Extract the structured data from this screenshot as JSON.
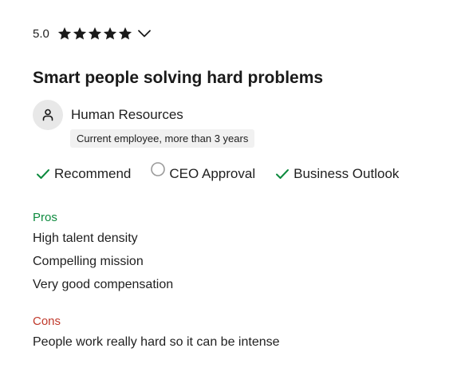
{
  "review": {
    "rating": "5.0",
    "stars": 5,
    "max_stars": 5,
    "title": "Smart people solving hard problems",
    "author": {
      "job_title": "Human Resources",
      "employment": "Current employee, more than 3 years"
    },
    "ratings": {
      "recommend": "Recommend",
      "ceo_approval": "CEO Approval",
      "business_outlook": "Business Outlook"
    },
    "pros": {
      "heading": "Pros",
      "lines": [
        "High talent density",
        "Compelling mission",
        "Very good compensation"
      ]
    },
    "cons": {
      "heading": "Cons",
      "lines": [
        "People work really hard so it can be intense"
      ]
    }
  },
  "colors": {
    "positive": "#0d8a3e",
    "negative": "#c0392b",
    "neutral": "#9a9a9a",
    "text": "#1f1f1f"
  },
  "icons": {
    "star": "star-icon",
    "chevron": "chevron-down-icon",
    "avatar": "person-icon",
    "positive": "check-icon",
    "neutral": "circle-icon"
  }
}
